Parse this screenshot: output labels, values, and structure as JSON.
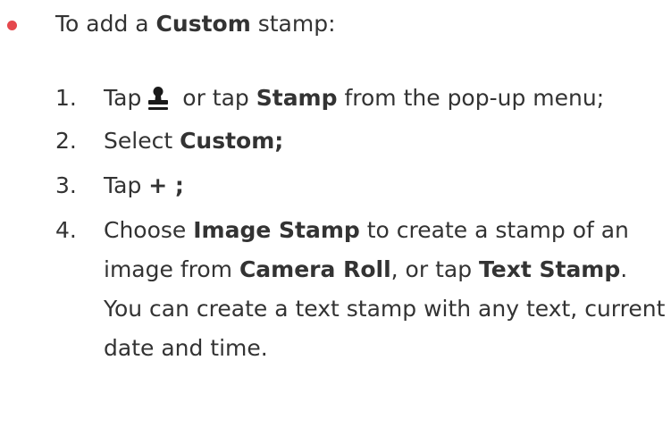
{
  "intro": {
    "prefix": "To add a ",
    "bold": "Custom",
    "suffix": " stamp:"
  },
  "steps": [
    {
      "number": "1.",
      "before_icon": "Tap",
      "icon": "stamp-icon",
      "after_icon": " or tap ",
      "bold": "Stamp",
      "tail": " from the pop-up menu;"
    },
    {
      "number": "2.",
      "text": "Select ",
      "bold": "Custom;"
    },
    {
      "number": "3.",
      "text": "Tap ",
      "bold": "+ ;"
    },
    {
      "number": "4.",
      "text1": "Choose ",
      "bold1": "Image Stamp",
      "text2": " to create a stamp of an image from ",
      "bold2": "Camera Roll",
      "text3": ", or tap ",
      "bold3": "Text Stamp",
      "text4": ". You can create a text stamp with any text, current date and time."
    }
  ],
  "colors": {
    "bullet": "#e5484d",
    "text": "#333333"
  }
}
